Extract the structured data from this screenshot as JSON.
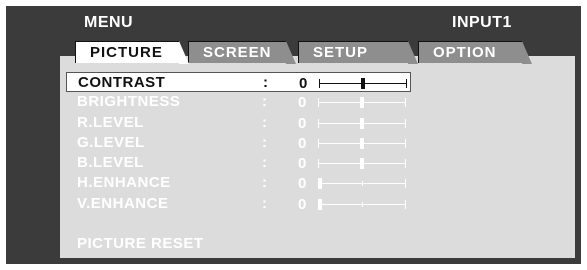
{
  "header": {
    "title": "MENU",
    "input": "INPUT1"
  },
  "tabs": [
    {
      "label": "PICTURE",
      "active": true
    },
    {
      "label": "SCREEN",
      "active": false
    },
    {
      "label": "SETUP",
      "active": false
    },
    {
      "label": "OPTION",
      "active": false
    }
  ],
  "menu": {
    "separator": ":",
    "items": [
      {
        "label": "CONTRAST",
        "value": "0",
        "level": 0.5
      },
      {
        "label": "BRIGHTNESS",
        "value": "0",
        "level": 0.5
      },
      {
        "label": "R.LEVEL",
        "value": "0",
        "level": 0.5
      },
      {
        "label": "G.LEVEL",
        "value": "0",
        "level": 0.5
      },
      {
        "label": "B.LEVEL",
        "value": "0",
        "level": 0.5
      },
      {
        "label": "H.ENHANCE",
        "value": "0",
        "level": 0.0
      },
      {
        "label": "V.ENHANCE",
        "value": "0",
        "level": 0.0
      }
    ],
    "selected_index": 0,
    "reset_label": "PICTURE RESET"
  },
  "colors": {
    "background": "#3b3b3b",
    "panel": "#dcdcdc",
    "tab_active": "#ffffff",
    "tab_inactive": "#8e8e8e",
    "text": "#ffffff",
    "selected_text": "#111111"
  }
}
